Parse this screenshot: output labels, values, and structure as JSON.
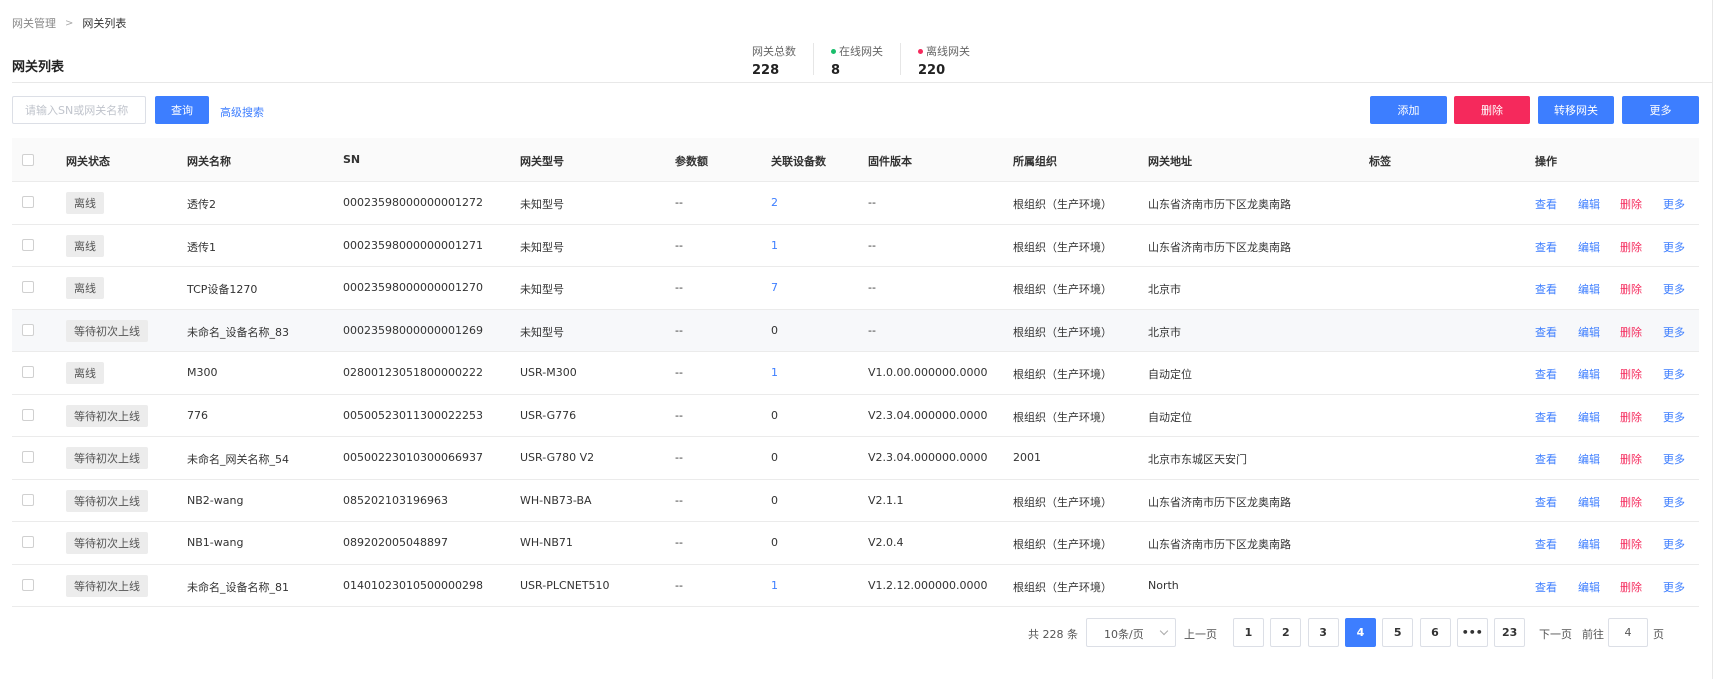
{
  "breadcrumb": {
    "parent": "网关管理",
    "current": "网关列表"
  },
  "page": {
    "title": "网关列表"
  },
  "stats": {
    "total_label": "网关总数",
    "total_value": "228",
    "online_label": "在线网关",
    "online_value": "8",
    "offline_label": "离线网关",
    "offline_value": "220",
    "online_color": "#19be6b",
    "offline_color": "#f5295c"
  },
  "toolbar": {
    "search_placeholder": "请输入SN或网关名称",
    "query_label": "查询",
    "advanced_label": "高级搜索",
    "add_label": "添加",
    "delete_label": "删除",
    "transfer_label": "转移网关",
    "more_label": "更多"
  },
  "table": {
    "headers": [
      "网关状态",
      "网关名称",
      "SN",
      "网关型号",
      "参数额",
      "关联设备数",
      "固件版本",
      "所属组织",
      "网关地址",
      "标签",
      "操作"
    ],
    "op_labels": [
      "查看",
      "编辑",
      "删除",
      "更多"
    ],
    "rows": [
      {
        "status": "离线",
        "name": "透传2",
        "sn": "00023598000000001272",
        "model": "未知型号",
        "param": "--",
        "devices": "2",
        "firmware": "--",
        "org": "根组织（生产环境）",
        "address": "山东省济南市历下区龙奥南路",
        "tag": ""
      },
      {
        "status": "离线",
        "name": "透传1",
        "sn": "00023598000000001271",
        "model": "未知型号",
        "param": "--",
        "devices": "1",
        "firmware": "--",
        "org": "根组织（生产环境）",
        "address": "山东省济南市历下区龙奥南路",
        "tag": ""
      },
      {
        "status": "离线",
        "name": "TCP设备1270",
        "sn": "00023598000000001270",
        "model": "未知型号",
        "param": "--",
        "devices": "7",
        "firmware": "--",
        "org": "根组织（生产环境）",
        "address": "北京市",
        "tag": ""
      },
      {
        "status": "等待初次上线",
        "name": "未命名_设备名称_83",
        "sn": "00023598000000001269",
        "model": "未知型号",
        "param": "--",
        "devices": "0",
        "firmware": "--",
        "org": "根组织（生产环境）",
        "address": "北京市",
        "tag": ""
      },
      {
        "status": "离线",
        "name": "M300",
        "sn": "02800123051800000222",
        "model": "USR-M300",
        "param": "--",
        "devices": "1",
        "firmware": "V1.0.00.000000.0000",
        "org": "根组织（生产环境）",
        "address": "自动定位",
        "tag": ""
      },
      {
        "status": "等待初次上线",
        "name": "776",
        "sn": "00500523011300022253",
        "model": "USR-G776",
        "param": "--",
        "devices": "0",
        "firmware": "V2.3.04.000000.0000",
        "org": "根组织（生产环境）",
        "address": "自动定位",
        "tag": ""
      },
      {
        "status": "等待初次上线",
        "name": "未命名_网关名称_54",
        "sn": "00500223010300066937",
        "model": "USR-G780 V2",
        "param": "--",
        "devices": "0",
        "firmware": "V2.3.04.000000.0000",
        "org": "2001",
        "address": "北京市东城区天安门",
        "tag": ""
      },
      {
        "status": "等待初次上线",
        "name": "NB2-wang",
        "sn": "085202103196963",
        "model": "WH-NB73-BA",
        "param": "--",
        "devices": "0",
        "firmware": "V2.1.1",
        "org": "根组织（生产环境）",
        "address": "山东省济南市历下区龙奥南路",
        "tag": ""
      },
      {
        "status": "等待初次上线",
        "name": "NB1-wang",
        "sn": "089202005048897",
        "model": "WH-NB71",
        "param": "--",
        "devices": "0",
        "firmware": "V2.0.4",
        "org": "根组织（生产环境）",
        "address": "山东省济南市历下区龙奥南路",
        "tag": ""
      },
      {
        "status": "等待初次上线",
        "name": "未命名_设备名称_81",
        "sn": "01401023010500000298",
        "model": "USR-PLCNET510",
        "param": "--",
        "devices": "1",
        "firmware": "V1.2.12.000000.0000",
        "org": "根组织（生产环境）",
        "address": "North",
        "tag": ""
      }
    ]
  },
  "pagination": {
    "total_text": "共 228 条",
    "page_size": "10条/页",
    "prev_label": "上一页",
    "next_label": "下一页",
    "goto_label": "前往",
    "goto_value": "4",
    "page_unit": "页",
    "pages": [
      "1",
      "2",
      "3",
      "4",
      "5",
      "6",
      "•••",
      "23"
    ],
    "current_page": "4"
  }
}
